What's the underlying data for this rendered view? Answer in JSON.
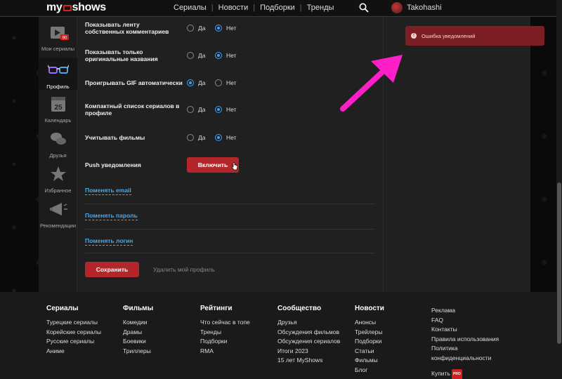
{
  "header": {
    "logo": {
      "prefix": "my",
      "suffix": "shows"
    },
    "nav": [
      "Сериалы",
      "Новости",
      "Подборки",
      "Тренды"
    ],
    "user": "Takohashi"
  },
  "sidebar": {
    "items": [
      {
        "label": "Мои сериалы",
        "badge": "90",
        "icon": "clapperboard-icon"
      },
      {
        "label": "Профиль",
        "icon": "glasses-icon",
        "active": true
      },
      {
        "label": "Календарь",
        "badge": "25",
        "icon": "calendar-icon"
      },
      {
        "label": "Друзья",
        "icon": "chat-bubbles-icon"
      },
      {
        "label": "Избранное",
        "icon": "star-icon"
      },
      {
        "label": "Рекомендации",
        "icon": "megaphone-icon"
      }
    ]
  },
  "settings": {
    "yes": "Да",
    "no": "Нет",
    "rows": [
      {
        "label": "Показывать ленту собственных комментариев",
        "selected": "no"
      },
      {
        "label": "Показывать только оригинальные названия",
        "selected": "no"
      },
      {
        "label": "Проигрывать GIF автоматически",
        "selected": "yes"
      },
      {
        "label": "Компактный список сериалов в профиле",
        "selected": "no"
      },
      {
        "label": "Учитывать фильмы",
        "selected": "no"
      }
    ],
    "push_label": "Push уведомления",
    "push_button": "Включить",
    "links": [
      "Поменять email",
      "Поменять пароль",
      "Поменять логин"
    ],
    "save_button": "Сохранить",
    "delete_link": "Удалить мой профиль"
  },
  "toast": {
    "text": "Ошибка уведомлений",
    "color": "#7c1f24"
  },
  "footer": {
    "columns": [
      {
        "head": "Сериалы",
        "links": [
          "Турецкие сериалы",
          "Корейские сериалы",
          "Русские сериалы",
          "Аниме"
        ]
      },
      {
        "head": "Фильмы",
        "links": [
          "Комедии",
          "Драмы",
          "Боевики",
          "Триллеры"
        ]
      },
      {
        "head": "Рейтинги",
        "links": [
          "Что сейчас в топе",
          "Тренды",
          "Подборки",
          "RMA"
        ]
      },
      {
        "head": "Сообщество",
        "links": [
          "Друзья",
          "Обсуждения фильмов",
          "Обсуждения сериалов",
          "Итоги 2023",
          "15 лет MyShows"
        ]
      },
      {
        "head": "Новости",
        "links": [
          "Анонсы",
          "Трейлеры",
          "Подборки",
          "Статьи",
          "Фильмы",
          "Блог"
        ]
      },
      {
        "head": "",
        "links": [
          "Реклама",
          "FAQ",
          "Контакты",
          "Правила использования",
          "Политика конфиденциальности"
        ]
      }
    ],
    "buy": "Купить",
    "pro_badge": "PRO"
  },
  "colors": {
    "accent": "#b3262a",
    "link": "#4aa8e8",
    "radio_on": "#3aa0ff",
    "arrow": "#ff1fc8"
  }
}
